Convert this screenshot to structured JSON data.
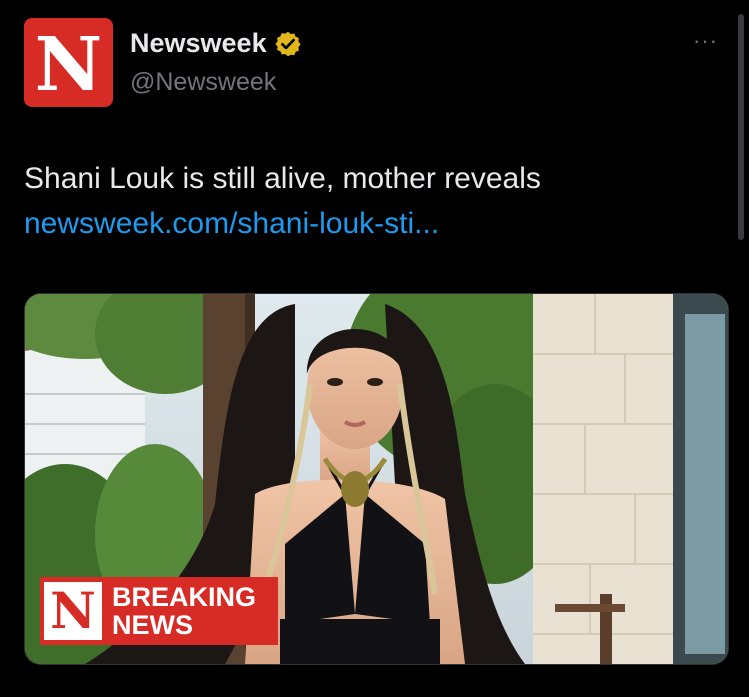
{
  "account": {
    "avatar_letter": "N",
    "name": "Newsweek",
    "handle": "@Newsweek",
    "verified_icon": "verified-badge-icon",
    "more_label": "···"
  },
  "tweet": {
    "text": "Shani Louk is still alive, mother reveals",
    "link": "newsweek.com/shani-louk-sti..."
  },
  "media": {
    "overlay": {
      "logo_letter": "N",
      "line1": "BREAKING",
      "line2": "NEWS"
    }
  },
  "colors": {
    "brand_red": "#d72b25",
    "link_blue": "#1d9bf0",
    "verified_gold": "#e2b719"
  }
}
